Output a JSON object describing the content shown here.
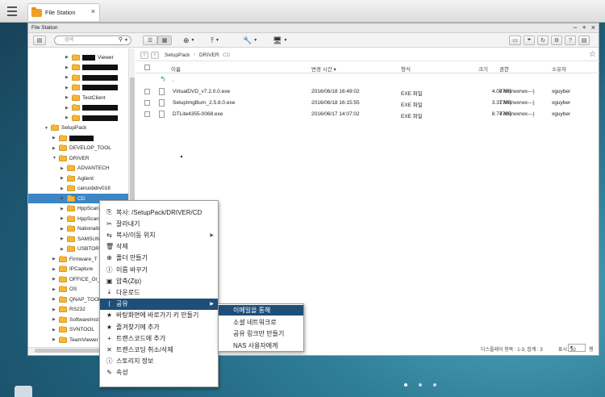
{
  "tab": {
    "title": "File Station"
  },
  "window": {
    "title": "File Station",
    "controls": [
      "−",
      "+",
      "×"
    ]
  },
  "search": {
    "placeholder": "검색"
  },
  "breadcrumb": [
    "SetupPack",
    "DRIVER",
    "CD"
  ],
  "columns": {
    "name": "이름",
    "modified": "변경 시간 ▾",
    "type": "형식",
    "size": "크기",
    "permission": "권한",
    "owner": "소유자"
  },
  "parent_row": {
    "label": ".."
  },
  "files": [
    {
      "name": "VirtualDVD_v7.2.0.0.exe",
      "modified": "2016/06/18 16:49:02",
      "type": "EXE 파일",
      "size": "4.08 MB",
      "permission": "770 (rwxrwx---)",
      "owner": "xguyber"
    },
    {
      "name": "SetupImgBurn_2.5.8.0.exe",
      "modified": "2016/06/18 16:15:55",
      "type": "EXE 파일",
      "size": "3.31 MB",
      "permission": "770 (rwxrwx---)",
      "owner": "xguyber"
    },
    {
      "name": "DTLite4355-0068.exe",
      "modified": "2016/06/17 14:07:02",
      "type": "EXE 파일",
      "size": "8.74 MB",
      "permission": "770 (rwxrwx---)",
      "owner": "xguyber"
    }
  ],
  "tree": {
    "top_items": [
      "Viewer",
      "",
      "",
      "",
      "TestClient",
      "",
      ""
    ],
    "setup_pack": "SetupPack",
    "items_a": [
      "",
      "DEVELOP_TOOL",
      "DRIVER"
    ],
    "driver_children": [
      "ADVANTECH",
      "Agilent",
      "canusbdrv018",
      "CD",
      "HppScan2",
      "HppScan7",
      "NationalIn",
      "SAMSUNG",
      "USBTORS"
    ],
    "items_b": [
      "Firmware_T",
      "IPCapture",
      "OFFICE_Or_E",
      "OS",
      "QNAP_TOOL",
      "RS232",
      "SoftwareInst",
      "SVNTOOL",
      "TeamViewer"
    ]
  },
  "context_menu": [
    {
      "icon": "copy-path-icon",
      "glyph": "⎘",
      "label": "복사: /SetupPack/DRIVER/CD"
    },
    {
      "icon": "cut-icon",
      "glyph": "✂",
      "label": "잘라내기"
    },
    {
      "icon": "copy-move-icon",
      "glyph": "⇆",
      "label": "복사/이동 위치",
      "sub": true
    },
    {
      "icon": "trash-icon",
      "glyph": "🗑",
      "label": "삭제"
    },
    {
      "icon": "new-folder-icon",
      "glyph": "⊕",
      "label": "폴더 만들기"
    },
    {
      "icon": "rename-icon",
      "glyph": "Ⓘ",
      "label": "이름 바꾸기"
    },
    {
      "icon": "zip-icon",
      "glyph": "▣",
      "label": "압축(Zip)"
    },
    {
      "icon": "download-icon",
      "glyph": "⤓",
      "label": "다운로드"
    },
    {
      "icon": "share-icon",
      "glyph": "⟨",
      "label": "공유",
      "sub": true,
      "active": true
    },
    {
      "icon": "shortcut-icon",
      "glyph": "★",
      "label": "바탕화면에 바로가기 키 만들기"
    },
    {
      "icon": "favorite-icon",
      "glyph": "★",
      "label": "즐겨찾기에 추가"
    },
    {
      "icon": "transcode-add-icon",
      "glyph": "+",
      "label": "트랜스코드에 추가"
    },
    {
      "icon": "transcode-cancel-icon",
      "glyph": "✕",
      "label": "트랜스코딩 취소/삭제"
    },
    {
      "icon": "storage-info-icon",
      "glyph": "ⓘ",
      "label": "스토리지 정보"
    },
    {
      "icon": "properties-icon",
      "glyph": "✎",
      "label": "속성"
    }
  ],
  "share_submenu": [
    "이메일을 통해",
    "소셜 네트워크로",
    "공유 링크만 만들기",
    "NAS 사용자에게"
  ],
  "status": {
    "display_items": "디스플레이 항목 : 1-3, 합계 : 3",
    "show_label": "표시",
    "per_page": "50",
    "rows_label": "행"
  }
}
